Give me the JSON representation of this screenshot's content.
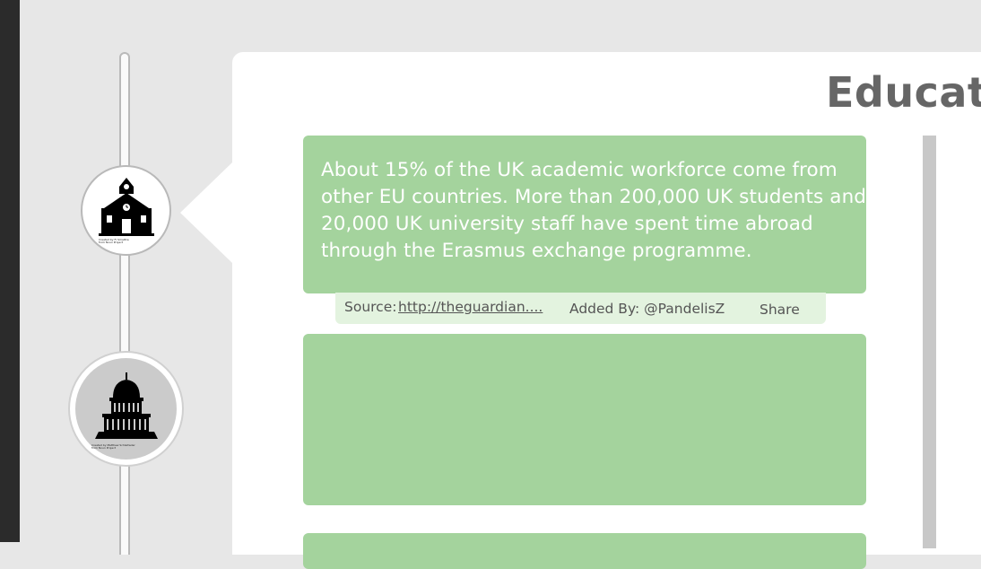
{
  "page": {
    "title": "Educati"
  },
  "timeline": {
    "nodes": [
      {
        "icon": "school-icon",
        "credit": [
          "Created by Fr Smalltre",
          "from Noun Project"
        ]
      },
      {
        "icon": "capitol-icon",
        "credit": [
          "Created by Matthew Schleitwiler",
          "from Noun Project"
        ]
      }
    ]
  },
  "cards": [
    {
      "text": "About 15% of the UK academic workforce come from other EU countries. More than 200,000 UK students and 20,000 UK university staff have spent time abroad through the Erasmus exchange programme.",
      "source_label": "Source:",
      "source_link": "http://theguardian....",
      "added_by": "Added By: @PandelisZ",
      "share": "Share"
    }
  ],
  "colors": {
    "card": "#a4d39d",
    "meta_bar": "#e3f3df",
    "title": "#666666",
    "background": "#e7e7e7"
  }
}
